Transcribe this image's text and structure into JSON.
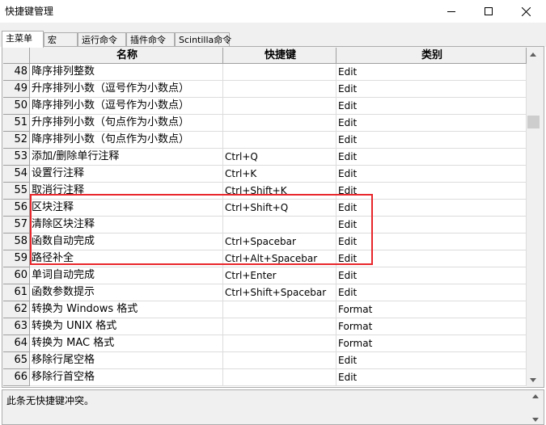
{
  "window": {
    "title": "快捷键管理",
    "minimize_label": "—",
    "close_label": "✕"
  },
  "tabs": [
    {
      "label": "主菜单",
      "active": true
    },
    {
      "label": "宏",
      "active": false
    },
    {
      "label": "运行命令",
      "active": false
    },
    {
      "label": "插件命令",
      "active": false
    },
    {
      "label": "Scintilla命令",
      "active": false
    }
  ],
  "table": {
    "columns": {
      "name": "名称",
      "shortcut": "快捷键",
      "category": "类别"
    },
    "rows": [
      {
        "num": "48",
        "name": "降序排列整数",
        "shortcut": "",
        "category": "Edit"
      },
      {
        "num": "49",
        "name": "升序排列小数（逗号作为小数点）",
        "shortcut": "",
        "category": "Edit"
      },
      {
        "num": "50",
        "name": "降序排列小数（逗号作为小数点）",
        "shortcut": "",
        "category": "Edit"
      },
      {
        "num": "51",
        "name": "升序排列小数（句点作为小数点）",
        "shortcut": "",
        "category": "Edit"
      },
      {
        "num": "52",
        "name": "降序排列小数（句点作为小数点）",
        "shortcut": "",
        "category": "Edit"
      },
      {
        "num": "53",
        "name": "添加/删除单行注释",
        "shortcut": "Ctrl+Q",
        "category": "Edit"
      },
      {
        "num": "54",
        "name": "设置行注释",
        "shortcut": "Ctrl+K",
        "category": "Edit"
      },
      {
        "num": "55",
        "name": "取消行注释",
        "shortcut": "Ctrl+Shift+K",
        "category": "Edit"
      },
      {
        "num": "56",
        "name": "区块注释",
        "shortcut": "Ctrl+Shift+Q",
        "category": "Edit"
      },
      {
        "num": "57",
        "name": "清除区块注释",
        "shortcut": "",
        "category": "Edit"
      },
      {
        "num": "58",
        "name": "函数自动完成",
        "shortcut": "Ctrl+Spacebar",
        "category": "Edit"
      },
      {
        "num": "59",
        "name": "路径补全",
        "shortcut": "Ctrl+Alt+Spacebar",
        "category": "Edit"
      },
      {
        "num": "60",
        "name": "单词自动完成",
        "shortcut": "Ctrl+Enter",
        "category": "Edit"
      },
      {
        "num": "61",
        "name": "函数参数提示",
        "shortcut": "Ctrl+Shift+Spacebar",
        "category": "Edit"
      },
      {
        "num": "62",
        "name": "转换为 Windows 格式",
        "shortcut": "",
        "category": "Format"
      },
      {
        "num": "63",
        "name": "转换为 UNIX 格式",
        "shortcut": "",
        "category": "Format"
      },
      {
        "num": "64",
        "name": "转换为 MAC 格式",
        "shortcut": "",
        "category": "Format"
      },
      {
        "num": "65",
        "name": "移除行尾空格",
        "shortcut": "",
        "category": "Edit"
      },
      {
        "num": "66",
        "name": "移除行首空格",
        "shortcut": "",
        "category": "Edit"
      }
    ]
  },
  "status": {
    "text": "此条无快捷键冲突。"
  },
  "colors": {
    "highlight_border": "#e8262b",
    "header_bg": "#f0f0f0"
  },
  "icons": [
    "minimize-icon",
    "maximize-icon",
    "close-icon",
    "scroll-up-icon",
    "scroll-down-icon"
  ]
}
